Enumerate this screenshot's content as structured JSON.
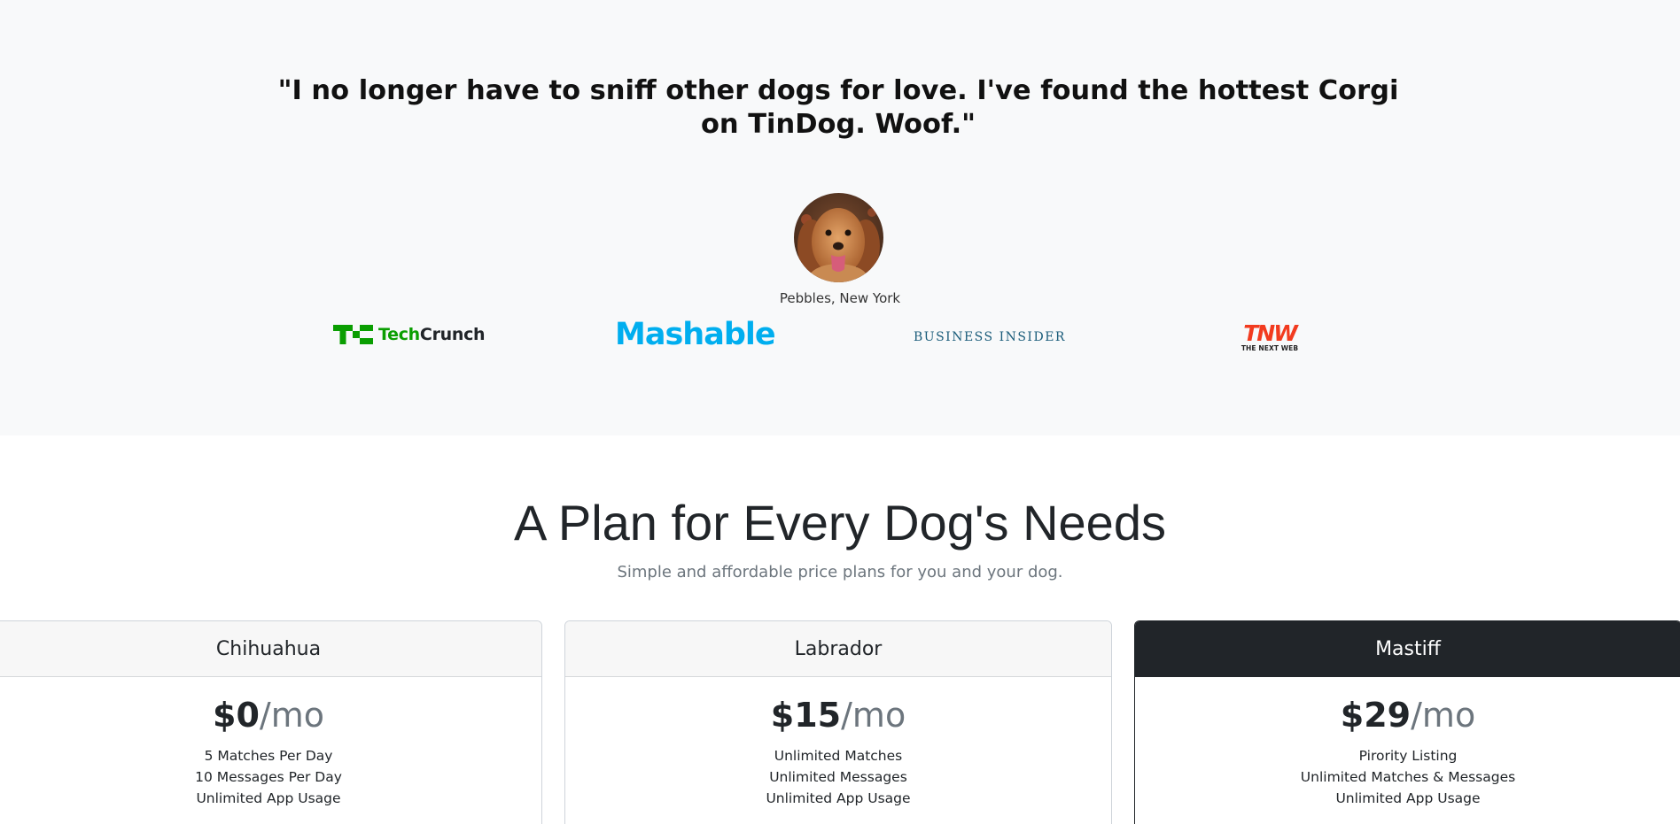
{
  "testimonial": {
    "quote": "\"I no longer have to sniff other dogs for love. I've found the hottest Corgi on TinDog. Woof.\"",
    "author": "Pebbles, New York"
  },
  "press": {
    "techcrunch": {
      "name": "TechCrunch",
      "part1": "Tech",
      "part2": "Crunch"
    },
    "mashable": "Mashable",
    "business_insider": "BUSINESS INSIDER",
    "tnw": {
      "big": "TNW",
      "small": "THE NEXT WEB"
    }
  },
  "pricing": {
    "title": "A Plan for Every Dog's Needs",
    "subtitle": "Simple and affordable price plans for you and your dog.",
    "plans": [
      {
        "name": "Chihuahua",
        "price": "$0",
        "period": "/mo",
        "features": [
          "5 Matches Per Day",
          "10 Messages Per Day",
          "Unlimited App Usage"
        ]
      },
      {
        "name": "Labrador",
        "price": "$15",
        "period": "/mo",
        "features": [
          "Unlimited Matches",
          "Unlimited Messages",
          "Unlimited App Usage"
        ]
      },
      {
        "name": "Mastiff",
        "price": "$29",
        "period": "/mo",
        "features": [
          "Pirority Listing",
          "Unlimited Matches & Messages",
          "Unlimited App Usage"
        ]
      }
    ]
  },
  "colors": {
    "testimonial_bg": "#f8f9fa",
    "techcrunch_green": "#0a9e01",
    "mashable_blue": "#00aeef",
    "business_insider_blue": "#1a5c7a",
    "tnw_red": "#f23b1f",
    "dark_header": "#212529"
  }
}
